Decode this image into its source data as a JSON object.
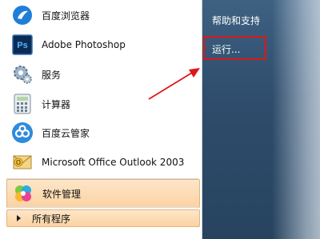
{
  "start_menu": {
    "programs": [
      {
        "label": "百度浏览器",
        "icon": "baidu-browser-icon"
      },
      {
        "label": "Adobe Photoshop",
        "icon": "photoshop-icon"
      },
      {
        "label": "服务",
        "icon": "services-gear-icon"
      },
      {
        "label": "计算器",
        "icon": "calculator-icon"
      },
      {
        "label": "百度云管家",
        "icon": "baidu-cloud-icon"
      },
      {
        "label": "Microsoft Office Outlook 2003",
        "icon": "outlook-icon"
      },
      {
        "label": "软件管理",
        "icon": "software-manager-icon"
      }
    ],
    "all_programs": "所有程序",
    "right_links": {
      "help": "帮助和支持",
      "run": "运行..."
    },
    "photoshop_icon_text": "Ps"
  },
  "colors": {
    "highlight": "#fbd3a2",
    "annotation": "#e01616"
  }
}
